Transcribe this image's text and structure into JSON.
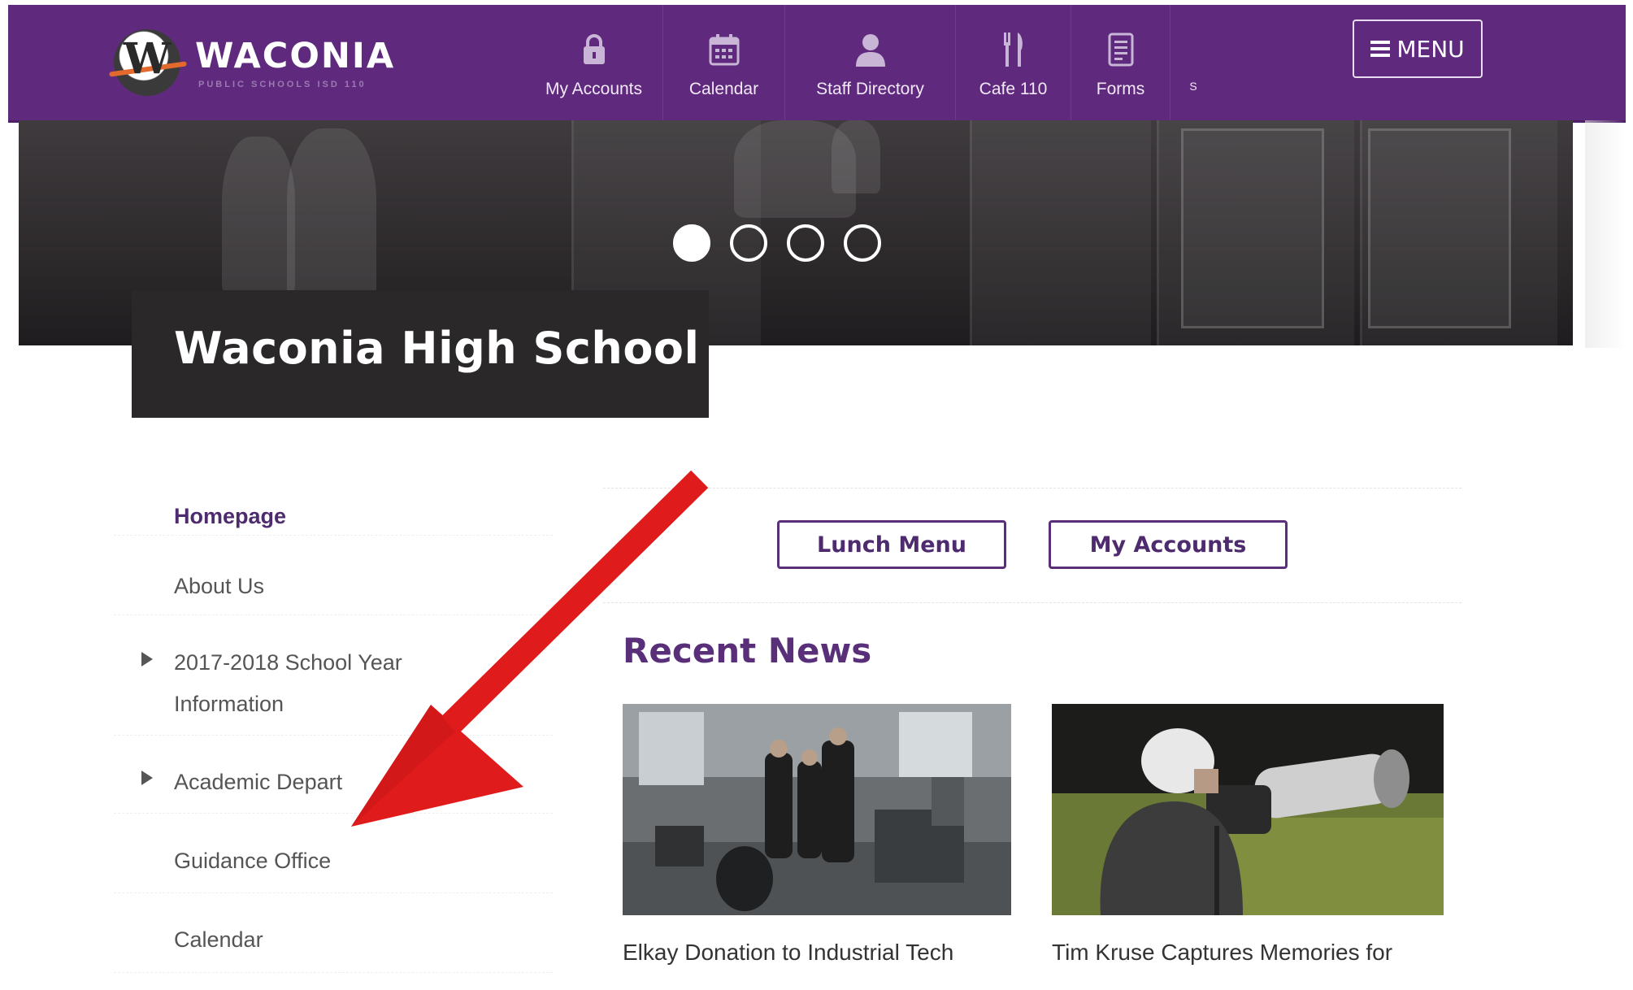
{
  "header": {
    "logo_name": "WACONIA",
    "logo_sub": "PUBLIC SCHOOLS ISD 110",
    "nav": [
      {
        "label": "My Accounts",
        "icon": "lock-icon"
      },
      {
        "label": "Calendar",
        "icon": "calendar-icon"
      },
      {
        "label": "Staff Directory",
        "icon": "person-icon"
      },
      {
        "label": "Cafe 110",
        "icon": "utensils-icon"
      },
      {
        "label": "Forms",
        "icon": "document-icon"
      },
      {
        "label": "S",
        "icon": ""
      }
    ],
    "menu_label": "MENU"
  },
  "hero": {
    "title": "Waconia High School",
    "slides_total": 4,
    "active_slide": 1
  },
  "sidebar": {
    "items": [
      {
        "label": "Homepage",
        "current": true,
        "expandable": false
      },
      {
        "label": "About Us",
        "current": false,
        "expandable": false
      },
      {
        "label": "2017-2018 School Year",
        "label2": "Information",
        "current": false,
        "expandable": true
      },
      {
        "label": "Academic Depart",
        "current": false,
        "expandable": true
      },
      {
        "label": "Guidance Office",
        "current": false,
        "expandable": false
      },
      {
        "label": "Calendar",
        "current": false,
        "expandable": false
      }
    ]
  },
  "quick_links": {
    "lunch_menu": "Lunch Menu",
    "my_accounts": "My Accounts"
  },
  "news": {
    "title": "Recent News",
    "items": [
      {
        "caption": "Elkay Donation to Industrial Tech"
      },
      {
        "caption": "Tim Kruse Captures Memories for"
      }
    ]
  },
  "colors": {
    "brand_purple": "#5f2a7e",
    "title_box": "#2b2829",
    "annotation_arrow": "#e01b1b"
  }
}
